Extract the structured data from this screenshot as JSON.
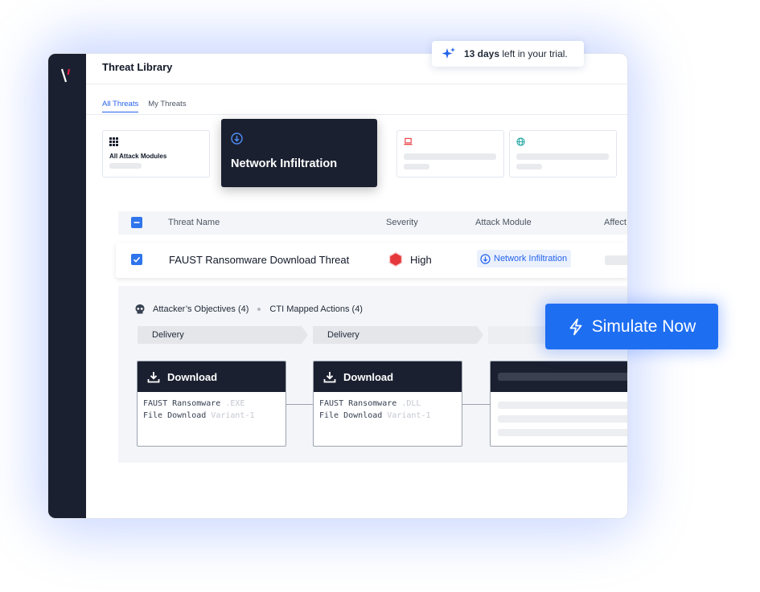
{
  "page": {
    "title": "Threat Library"
  },
  "tabs": [
    {
      "label": "All Threats",
      "active": true
    },
    {
      "label": "My Threats",
      "active": false
    }
  ],
  "cards": {
    "all_modules": {
      "label": "All Attack Modules",
      "icon": "grid-icon"
    },
    "featured": {
      "label": "Network Infiltration",
      "icon": "download-circle-icon"
    },
    "card3": {
      "icon": "laptop-icon"
    },
    "card4": {
      "icon": "globe-icon"
    }
  },
  "table": {
    "headers": {
      "name": "Threat Name",
      "severity": "Severity",
      "module": "Attack Module",
      "affected": "Affect"
    },
    "row": {
      "name": "FAUST Ransomware Download Threat",
      "severity": "High",
      "module": "Network Infiltration"
    }
  },
  "detail": {
    "objectives": "Attacker’s Objectives (4)",
    "cti": "CTI Mapped Actions (4)",
    "stages": [
      "Delivery",
      "Delivery"
    ],
    "nodes": [
      {
        "title": "Download",
        "line1_main": "FAUST Ransomware ",
        "line1_dim": ".EXE",
        "line2_main": "File Download ",
        "line2_dim": "Variant-1"
      },
      {
        "title": "Download",
        "line1_main": "FAUST Ransomware ",
        "line1_dim": ".DLL",
        "line2_main": "File Download ",
        "line2_dim": "Variant-1"
      }
    ]
  },
  "trial": {
    "days": "13 days",
    "rest": " left in your trial."
  },
  "cta": {
    "label": "Simulate Now"
  },
  "colors": {
    "accent": "#1e6ef2",
    "dark": "#1b2030",
    "severity_high": "#e5383b"
  }
}
